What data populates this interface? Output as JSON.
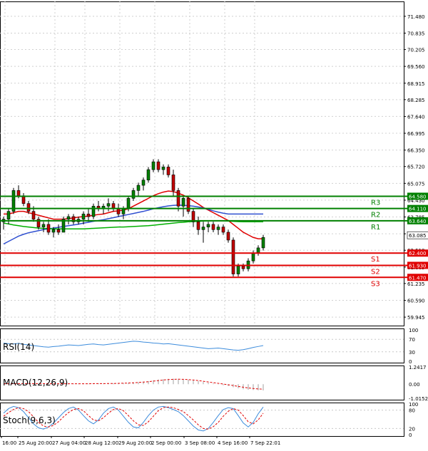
{
  "chart_data": {
    "type": "candlestick",
    "main": {
      "ylim": [
        59.62,
        72.05
      ],
      "price_ticks": [
        "71.480",
        "70.835",
        "70.205",
        "69.560",
        "68.915",
        "68.285",
        "67.640",
        "66.995",
        "66.350",
        "65.720",
        "65.075",
        "64.430",
        "63.785",
        "63.140",
        "62.510",
        "61.865",
        "61.235",
        "60.590",
        "59.945"
      ],
      "levels": [
        {
          "label": "R3",
          "value": 64.58,
          "price_tag": "64.580",
          "color": "#008000"
        },
        {
          "label": "R2",
          "value": 64.11,
          "price_tag": "64.110",
          "color": "#008000"
        },
        {
          "label": "R1",
          "value": 63.64,
          "price_tag": "63.640",
          "color": "#008000"
        },
        {
          "label": "S1",
          "value": 62.4,
          "price_tag": "62.400",
          "color": "#e00000"
        },
        {
          "label": "S2",
          "value": 61.93,
          "price_tag": "61.930",
          "color": "#e00000"
        },
        {
          "label": "S3",
          "value": 61.47,
          "price_tag": "61.470",
          "color": "#e00000"
        }
      ],
      "current_price": {
        "value": 63.085,
        "price_tag": "63.085"
      },
      "candles": [
        [
          63.6,
          63.8,
          63.3,
          63.7
        ],
        [
          63.7,
          64.1,
          63.5,
          64.0
        ],
        [
          64.0,
          64.9,
          63.9,
          64.8
        ],
        [
          64.8,
          65.0,
          64.5,
          64.6
        ],
        [
          64.6,
          64.7,
          64.2,
          64.3
        ],
        [
          64.3,
          64.4,
          63.9,
          64.0
        ],
        [
          64.0,
          64.2,
          63.6,
          63.7
        ],
        [
          63.7,
          63.8,
          63.3,
          63.4
        ],
        [
          63.4,
          63.6,
          63.2,
          63.5
        ],
        [
          63.5,
          63.7,
          63.1,
          63.2
        ],
        [
          63.2,
          63.4,
          63.0,
          63.3
        ],
        [
          63.3,
          63.5,
          63.1,
          63.2
        ],
        [
          63.2,
          63.8,
          63.2,
          63.7
        ],
        [
          63.7,
          63.9,
          63.5,
          63.8
        ],
        [
          63.8,
          63.9,
          63.5,
          63.6
        ],
        [
          63.6,
          63.8,
          63.5,
          63.7
        ],
        [
          63.7,
          64.0,
          63.5,
          63.9
        ],
        [
          63.9,
          64.1,
          63.6,
          63.8
        ],
        [
          63.8,
          64.3,
          63.7,
          64.2
        ],
        [
          64.2,
          64.4,
          64.0,
          64.1
        ],
        [
          64.1,
          64.3,
          63.9,
          64.2
        ],
        [
          64.2,
          64.5,
          64.0,
          64.3
        ],
        [
          64.3,
          64.4,
          64.0,
          64.1
        ],
        [
          64.1,
          64.3,
          63.8,
          63.9
        ],
        [
          63.9,
          64.2,
          63.7,
          64.1
        ],
        [
          64.1,
          64.6,
          64.0,
          64.5
        ],
        [
          64.5,
          64.9,
          64.4,
          64.8
        ],
        [
          64.8,
          65.1,
          64.6,
          65.0
        ],
        [
          65.0,
          65.3,
          64.8,
          65.2
        ],
        [
          65.2,
          65.7,
          65.1,
          65.6
        ],
        [
          65.6,
          66.0,
          65.5,
          65.9
        ],
        [
          65.9,
          66.0,
          65.5,
          65.6
        ],
        [
          65.6,
          65.8,
          65.4,
          65.7
        ],
        [
          65.7,
          65.8,
          65.3,
          65.4
        ],
        [
          65.4,
          65.6,
          64.6,
          64.8
        ],
        [
          64.8,
          64.9,
          64.0,
          64.2
        ],
        [
          64.2,
          64.6,
          63.8,
          64.5
        ],
        [
          64.5,
          64.6,
          63.9,
          64.0
        ],
        [
          64.0,
          64.1,
          63.4,
          63.6
        ],
        [
          63.6,
          63.8,
          63.1,
          63.3
        ],
        [
          63.3,
          63.6,
          62.8,
          63.4
        ],
        [
          63.4,
          63.6,
          63.2,
          63.5
        ],
        [
          63.5,
          63.6,
          63.2,
          63.3
        ],
        [
          63.3,
          63.5,
          63.1,
          63.4
        ],
        [
          63.4,
          63.5,
          63.1,
          63.2
        ],
        [
          63.2,
          63.3,
          62.8,
          62.9
        ],
        [
          62.9,
          63.0,
          61.5,
          61.6
        ],
        [
          61.6,
          62.0,
          61.5,
          61.9
        ],
        [
          61.9,
          62.0,
          61.7,
          61.8
        ],
        [
          61.8,
          62.2,
          61.7,
          62.1
        ],
        [
          62.1,
          62.5,
          62.0,
          62.4
        ],
        [
          62.4,
          62.7,
          62.3,
          62.6
        ],
        [
          62.6,
          63.1,
          62.5,
          63.0
        ]
      ],
      "series": [
        {
          "name": "",
          "color": "#e00000",
          "values": [
            63.9,
            63.9,
            63.95,
            64.0,
            64.0,
            63.95,
            63.9,
            63.85,
            63.8,
            63.75,
            63.7,
            63.7,
            63.7,
            63.72,
            63.75,
            63.78,
            63.8,
            63.82,
            63.85,
            63.88,
            63.9,
            63.95,
            64.0,
            64.02,
            64.05,
            64.1,
            64.2,
            64.3,
            64.4,
            64.5,
            64.6,
            64.68,
            64.74,
            64.78,
            64.76,
            64.7,
            64.62,
            64.52,
            64.4,
            64.28,
            64.15,
            64.05,
            63.95,
            63.85,
            63.75,
            63.65,
            63.5,
            63.35,
            63.2,
            63.1,
            63.0,
            62.95,
            62.95
          ]
        },
        {
          "name": "",
          "color": "#3050d0",
          "values": [
            62.75,
            62.85,
            62.95,
            63.05,
            63.12,
            63.18,
            63.22,
            63.26,
            63.3,
            63.33,
            63.36,
            63.39,
            63.42,
            63.45,
            63.48,
            63.51,
            63.55,
            63.58,
            63.62,
            63.65,
            63.68,
            63.72,
            63.76,
            63.8,
            63.84,
            63.88,
            63.92,
            63.96,
            64.0,
            64.05,
            64.1,
            64.14,
            64.18,
            64.21,
            64.23,
            64.24,
            64.23,
            64.22,
            64.2,
            64.17,
            64.13,
            64.08,
            64.02,
            63.97,
            63.93,
            63.9,
            63.9,
            63.9,
            63.9,
            63.9,
            63.9,
            63.9,
            63.9
          ]
        },
        {
          "name": "",
          "color": "#00b000",
          "values": [
            63.55,
            63.52,
            63.48,
            63.45,
            63.42,
            63.4,
            63.38,
            63.36,
            63.35,
            63.34,
            63.33,
            63.33,
            63.33,
            63.33,
            63.33,
            63.33,
            63.33,
            63.34,
            63.35,
            63.36,
            63.37,
            63.38,
            63.39,
            63.4,
            63.4,
            63.41,
            63.42,
            63.43,
            63.44,
            63.45,
            63.47,
            63.49,
            63.51,
            63.53,
            63.55,
            63.57,
            63.58,
            63.6,
            63.61,
            63.62,
            63.63,
            63.64,
            63.64,
            63.64,
            63.64,
            63.63,
            63.62,
            63.61,
            63.6,
            63.6,
            63.6,
            63.6,
            63.6
          ]
        }
      ]
    },
    "rsi": {
      "label": "RSI(14)",
      "ylim": [
        0,
        100
      ],
      "ticks": [
        "100",
        "70",
        "30",
        "0"
      ],
      "values": [
        58,
        56,
        55,
        57,
        54,
        52,
        50,
        48,
        46,
        45,
        47,
        48,
        50,
        52,
        51,
        50,
        52,
        54,
        55,
        53,
        52,
        54,
        56,
        58,
        60,
        62,
        64,
        63,
        61,
        60,
        58,
        57,
        55,
        56,
        54,
        52,
        50,
        48,
        46,
        44,
        42,
        40,
        41,
        42,
        40,
        38,
        36,
        35,
        37,
        40,
        44,
        47,
        50
      ]
    },
    "macd": {
      "label": "MACD(12,26,9)",
      "ylim": [
        -1.0152,
        1.2417
      ],
      "ticks": [
        "1.2417",
        "0.00",
        "-1.0152"
      ],
      "histogram": [
        0,
        0.02,
        0.03,
        0.04,
        0.05,
        0.05,
        0.05,
        0.04,
        0.04,
        0.03,
        0.02,
        0.02,
        0.02,
        0.02,
        0.03,
        0.03,
        0.03,
        0.03,
        0.04,
        0.04,
        0.05,
        0.05,
        0.06,
        0.07,
        0.08,
        0.1,
        0.12,
        0.15,
        0.18,
        0.22,
        0.28,
        0.33,
        0.36,
        0.38,
        0.39,
        0.38,
        0.36,
        0.32,
        0.28,
        0.22,
        0.16,
        0.1,
        0.04,
        -0.02,
        -0.08,
        -0.14,
        -0.22,
        -0.3,
        -0.36,
        -0.4,
        -0.42,
        -0.44,
        -0.45
      ],
      "signal": [
        0.03,
        0.03,
        0.03,
        0.04,
        0.04,
        0.04,
        0.04,
        0.04,
        0.04,
        0.03,
        0.03,
        0.03,
        0.03,
        0.03,
        0.03,
        0.03,
        0.03,
        0.03,
        0.04,
        0.04,
        0.04,
        0.05,
        0.05,
        0.06,
        0.07,
        0.08,
        0.1,
        0.12,
        0.15,
        0.18,
        0.22,
        0.26,
        0.3,
        0.33,
        0.35,
        0.36,
        0.35,
        0.33,
        0.3,
        0.26,
        0.21,
        0.16,
        0.11,
        0.06,
        0.01,
        -0.04,
        -0.1,
        -0.16,
        -0.22,
        -0.27,
        -0.31,
        -0.34,
        -0.36
      ]
    },
    "stoch": {
      "label": "Stoch(9,6,3)",
      "ylim": [
        0,
        100
      ],
      "ticks": [
        "100",
        "80",
        "20",
        "0"
      ],
      "k": [
        70,
        85,
        92,
        88,
        75,
        55,
        35,
        22,
        18,
        25,
        38,
        55,
        72,
        85,
        90,
        80,
        62,
        45,
        35,
        48,
        70,
        85,
        90,
        80,
        60,
        40,
        25,
        22,
        40,
        62,
        80,
        90,
        92,
        88,
        82,
        75,
        62,
        45,
        28,
        15,
        12,
        20,
        40,
        62,
        82,
        88,
        85,
        62,
        38,
        25,
        40,
        68,
        90
      ],
      "d": [
        60,
        72,
        82,
        88,
        85,
        75,
        58,
        40,
        28,
        25,
        30,
        42,
        58,
        72,
        82,
        85,
        78,
        62,
        48,
        45,
        55,
        70,
        82,
        85,
        78,
        62,
        45,
        32,
        30,
        42,
        60,
        78,
        88,
        90,
        88,
        82,
        75,
        62,
        48,
        32,
        20,
        18,
        26,
        40,
        60,
        76,
        85,
        80,
        62,
        42,
        35,
        48,
        70
      ]
    },
    "x_labels": [
      "16:00",
      "25 Aug 20:00",
      "27 Aug 04:00",
      "28 Aug 12:00",
      "29 Aug 20:00",
      "2 Sep 00:00",
      "3 Sep 08:00",
      "4 Sep 16:00",
      "7 Sep 22:01"
    ]
  }
}
